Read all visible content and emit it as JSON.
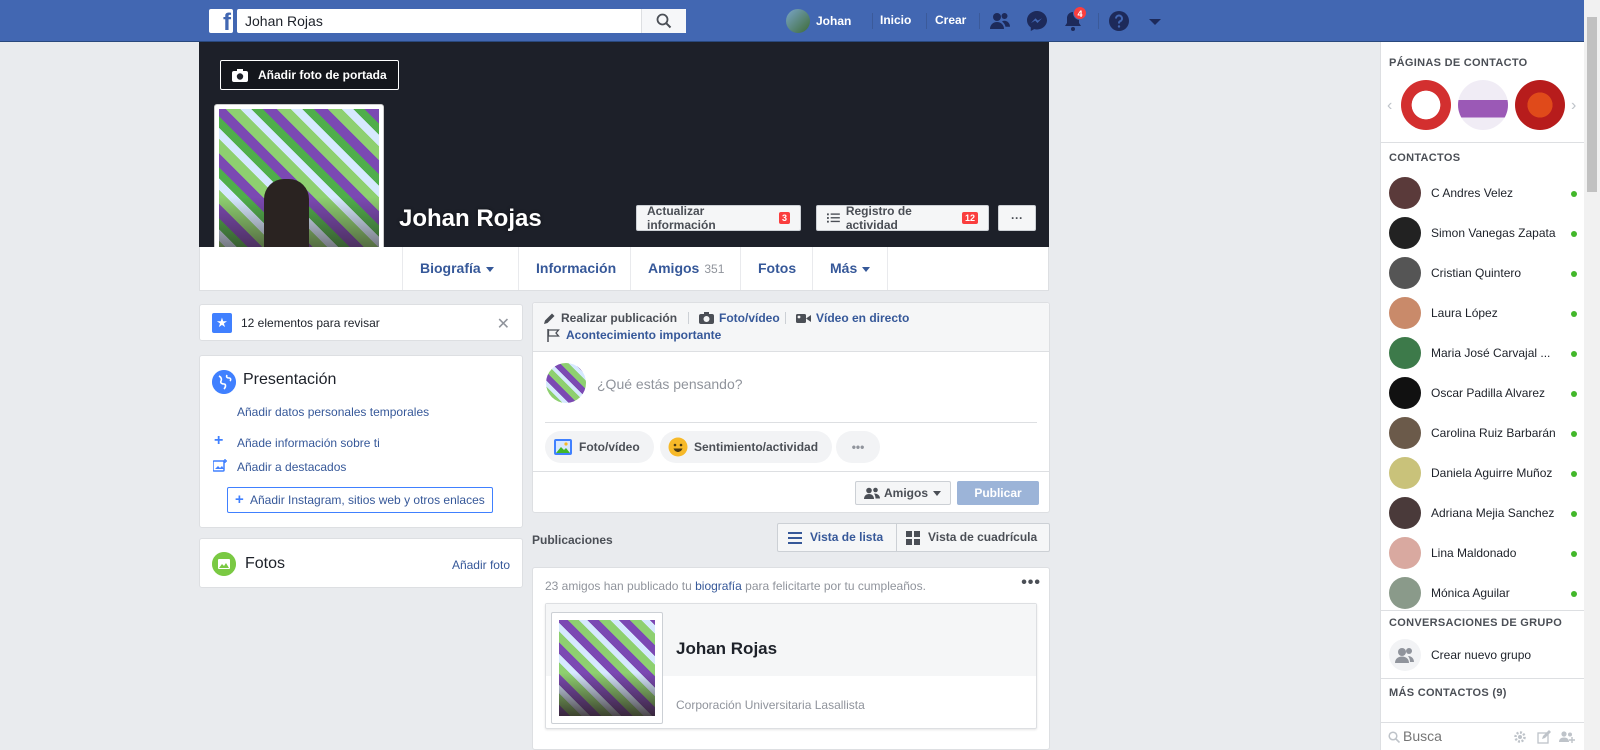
{
  "topbar": {
    "logo": "f",
    "search_value": "Johan Rojas",
    "user_name": "Johan",
    "links": [
      "Inicio",
      "Crear"
    ],
    "notification_count": "4",
    "icons": [
      "friends-icon",
      "messenger-icon",
      "bell-icon",
      "help-icon",
      "menu-caret-icon"
    ],
    "color": "#4267b2"
  },
  "cover": {
    "add_cover_label": "Añadir foto de portada",
    "name": "Johan Rojas",
    "update_info_label": "Actualizar información",
    "update_info_count": "3",
    "activity_log_label": "Registro de actividad",
    "activity_log_count": "12",
    "more_label": "···"
  },
  "tabs": [
    {
      "label": "Biografía"
    },
    {
      "label": "Información"
    },
    {
      "label": "Amigos",
      "sub": "351"
    },
    {
      "label": "Fotos"
    },
    {
      "label": "Más"
    }
  ],
  "review": {
    "text": "12 elementos para revisar",
    "close": "✕"
  },
  "presentation": {
    "title": "Presentación",
    "link_temp": "Añadir datos personales temporales",
    "link_info": "Añade información sobre ti",
    "link_featured": "Añadir a destacados",
    "link_instagram": "Añadir Instagram, sitios web y otros enlaces"
  },
  "photos": {
    "title": "Fotos",
    "add": "Añadir foto"
  },
  "composer": {
    "tab_post": "Realizar publicación",
    "tab_photo": "Foto/vídeo",
    "tab_live": "Vídeo en directo",
    "tab_event": "Acontecimiento importante",
    "placeholder": "¿Qué estás pensando?",
    "pill_photo": "Foto/vídeo",
    "pill_feeling": "Sentimiento/actividad",
    "pill_more": "•••",
    "audience": "Amigos",
    "publish": "Publicar"
  },
  "publications": {
    "label": "Publicaciones",
    "list_view": "Vista de lista",
    "grid_view": "Vista de cuadrícula"
  },
  "post": {
    "text_before": "23 amigos han publicado tu ",
    "text_link": "biografía",
    "text_after": " para felicitarte por tu cumpleaños.",
    "dots": "•••",
    "name": "Johan Rojas",
    "org": "Corporación Universitaria Lasallista"
  },
  "sidebar": {
    "pages_header": "PÁGINAS DE CONTACTO",
    "contacts_header": "CONTACTOS",
    "contacts": [
      {
        "name": "C Andres Velez",
        "color": "#5a3a3a"
      },
      {
        "name": "Simon Vanegas Zapata",
        "color": "#222222"
      },
      {
        "name": "Cristian Quintero",
        "color": "#555555"
      },
      {
        "name": "Laura López",
        "color": "#c98a6a"
      },
      {
        "name": "Maria José Carvajal ...",
        "color": "#3d7a4a"
      },
      {
        "name": "Oscar Padilla Alvarez",
        "color": "#111111"
      },
      {
        "name": "Carolina Ruiz Barbarán",
        "color": "#6b5a4a"
      },
      {
        "name": "Daniela Aguirre Muñoz",
        "color": "#c9c27a"
      },
      {
        "name": "Adriana Mejia Sanchez",
        "color": "#4a3a3a"
      },
      {
        "name": "Lina Maldonado",
        "color": "#d9a9a0"
      },
      {
        "name": "Mónica Aguilar",
        "color": "#8a9a8a"
      }
    ],
    "group_header": "CONVERSACIONES DE GRUPO",
    "new_group": "Crear nuevo grupo",
    "more_contacts_header": "MÁS CONTACTOS (9)",
    "search_placeholder": "Busca"
  }
}
